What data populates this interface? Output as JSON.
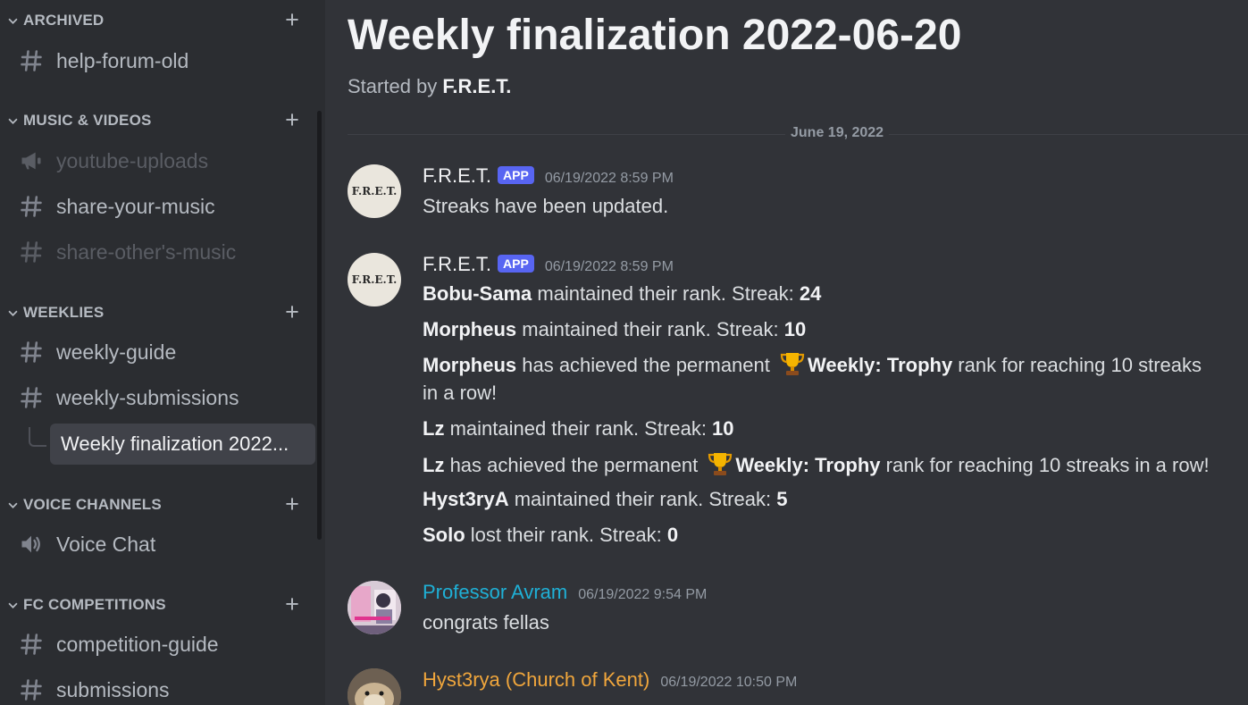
{
  "sidebar": {
    "categories": {
      "archived": "ARCHIVED",
      "music": "MUSIC & VIDEOS",
      "weeklies": "WEEKLIES",
      "voice": "VOICE CHANNELS",
      "fc": "FC COMPETITIONS"
    },
    "channels": {
      "help_forum_old": "help-forum-old",
      "youtube_uploads": "youtube-uploads",
      "share_your_music": "share-your-music",
      "share_others_music": "share-other's-music",
      "weekly_guide": "weekly-guide",
      "weekly_submissions": "weekly-submissions",
      "active_thread": "Weekly finalization 2022...",
      "voice_chat": "Voice Chat",
      "competition_guide": "competition-guide",
      "submissions": "submissions"
    }
  },
  "thread": {
    "title": "Weekly finalization 2022-06-20",
    "started_by_prefix": "Started by",
    "started_by_name": "F.R.E.T."
  },
  "date_divider": "June 19, 2022",
  "messages": [
    {
      "author": "F.R.E.T.",
      "badge": "APP",
      "timestamp": "06/19/2022 8:59 PM",
      "avatar_text": "F.R.E.T.",
      "text": "Streaks have been updated."
    },
    {
      "author": "F.R.E.T.",
      "badge": "APP",
      "timestamp": "06/19/2022 8:59 PM",
      "avatar_text": "F.R.E.T.",
      "lines": [
        {
          "name": "Bobu-Sama",
          "text": " maintained their rank. Streak: ",
          "value": "24"
        },
        {
          "name": "Morpheus",
          "text": " maintained their rank. Streak: ",
          "value": "10"
        },
        {
          "name": "Morpheus",
          "text": " has achieved the permanent ",
          "rank": "Weekly: Trophy",
          "tail": " rank for reaching 10 streaks",
          "wrap": "in a row!"
        },
        {
          "name": "Lz",
          "text": " maintained their rank. Streak: ",
          "value": "10"
        },
        {
          "name": "Lz",
          "text": " has achieved the permanent ",
          "rank": "Weekly: Trophy",
          "tail": " rank for reaching 10 streaks in a row!"
        },
        {
          "name": "Hyst3ryA",
          "text": " maintained their rank. Streak: ",
          "value": "5"
        },
        {
          "name": "Solo",
          "text": " lost their rank. Streak: ",
          "value": "0"
        }
      ]
    },
    {
      "author": "Professor Avram",
      "author_color": "#1fb0d6",
      "timestamp": "06/19/2022 9:54 PM",
      "text": "congrats fellas"
    },
    {
      "author": "Hyst3rya (Church of Kent)",
      "author_color": "#f0a63c",
      "timestamp": "06/19/2022 10:50 PM"
    }
  ],
  "colors": {
    "sidebar_bg": "#2b2d31",
    "main_bg": "#313338",
    "app_badge": "#5865f2",
    "selected_thread_bg": "#404249"
  }
}
